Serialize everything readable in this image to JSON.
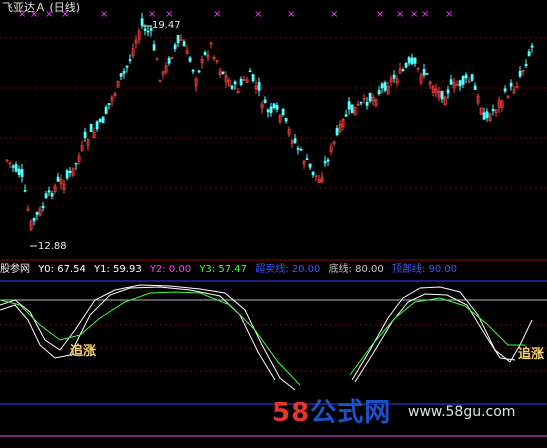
{
  "header": {
    "title": "飞亚达Ａ (日线)"
  },
  "price_chart": {
    "high_label": "19.47",
    "low_label": "12.88",
    "markers": [
      "×",
      "×",
      "×",
      "×",
      "×",
      "×",
      "×",
      "×",
      "×",
      "×",
      "×",
      "×",
      "×",
      "×",
      "×",
      "×"
    ]
  },
  "indicator": {
    "name": "股参网",
    "values": [
      {
        "label": "Y0: 67.54",
        "color": "#ffffff"
      },
      {
        "label": "Y1: 59.93",
        "color": "#ffffff"
      },
      {
        "label": "Y2: 0.00",
        "color": "#ff40ff"
      },
      {
        "label": "Y3: 57.47",
        "color": "#3cff3c"
      },
      {
        "label": "超卖线: 20.00",
        "color": "#3b5bff"
      },
      {
        "label": "底线: 80.00",
        "color": "#c8c8c8"
      },
      {
        "label": "顶部线: 90.00",
        "color": "#3b5bff"
      }
    ],
    "tags": [
      "追涨",
      "追涨"
    ]
  },
  "watermark": {
    "logo": "58公式网",
    "url": "www.58gu.com"
  },
  "colors": {
    "up": "#ff4040",
    "down": "#54ffff",
    "bg": "#000000",
    "grid": "#7f0000"
  }
}
